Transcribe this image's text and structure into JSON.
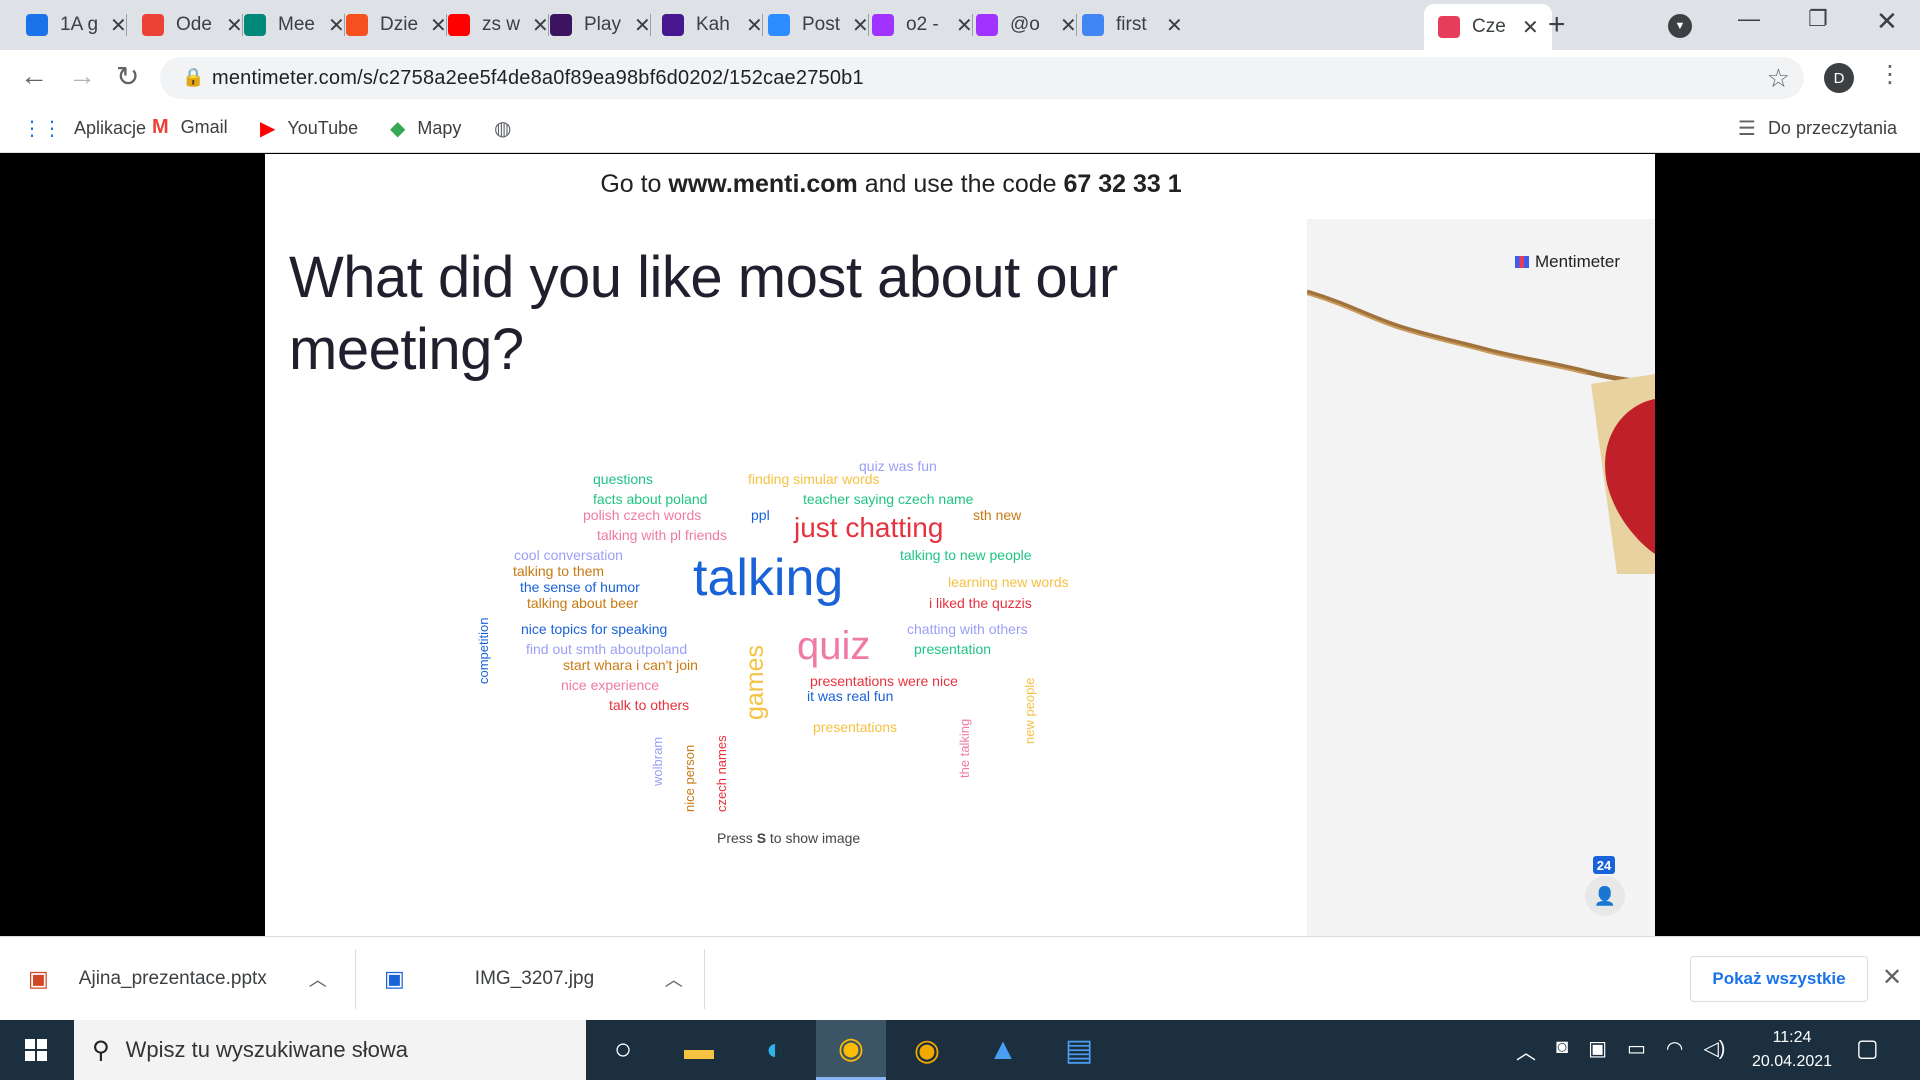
{
  "browser": {
    "tabs": [
      {
        "title": "1A g",
        "icon": "contacts-icon",
        "color": "#1a73e8"
      },
      {
        "title": "Ode",
        "icon": "gmail-icon",
        "color": "#ea4335"
      },
      {
        "title": "Mee",
        "icon": "meet-icon",
        "color": "#00897b"
      },
      {
        "title": "Dzie",
        "icon": "plus-app-icon",
        "color": "#f4511e"
      },
      {
        "title": "zs w",
        "icon": "youtube-icon",
        "color": "#ff0000"
      },
      {
        "title": "Play",
        "icon": "quizlet-icon",
        "color": "#3c1361"
      },
      {
        "title": "Kah",
        "icon": "kahoot-icon",
        "color": "#46178f"
      },
      {
        "title": "Post",
        "icon": "zoom-icon",
        "color": "#2d8cff"
      },
      {
        "title": "o2 -",
        "icon": "messenger-icon",
        "color": "#a033ff"
      },
      {
        "title": "@o",
        "icon": "messenger-icon",
        "color": "#a033ff"
      },
      {
        "title": "first",
        "icon": "google-icon",
        "color": "#4285f4"
      },
      {
        "title": "Cze",
        "icon": "mentimeter-icon",
        "color": "#e63d5a"
      }
    ],
    "url": "mentimeter.com/s/c2758a2ee5f4de8a0f89ea98bf6d0202/152cae2750b1",
    "profile_initial": "D",
    "bookmarks": [
      {
        "label": "Aplikacje",
        "icon": "apps-grid-icon"
      },
      {
        "label": "Gmail",
        "icon": "gmail-icon"
      },
      {
        "label": "YouTube",
        "icon": "youtube-icon"
      },
      {
        "label": "Mapy",
        "icon": "maps-icon"
      },
      {
        "label": "",
        "icon": "globe-icon"
      }
    ],
    "reading_list": "Do przeczytania"
  },
  "slide": {
    "code_prefix": "Go to ",
    "code_site": "www.menti.com",
    "code_middle": " and use the code ",
    "code_value": "67 32 33 1",
    "question": "What did you like most about our meeting?",
    "press_hint_pre": "Press ",
    "press_hint_key": "S",
    "press_hint_post": " to show image",
    "brand": "Mentimeter",
    "participants": "24"
  },
  "wordcloud": [
    {
      "text": "questions",
      "color": "#20c386"
    },
    {
      "text": "finding simular words",
      "color": "#f5c242"
    },
    {
      "text": "quiz was fun",
      "color": "#9a9ff5"
    },
    {
      "text": "facts about poland",
      "color": "#20c386"
    },
    {
      "text": "teacher saying czech name",
      "color": "#20c386"
    },
    {
      "text": "polish czech words",
      "color": "#f07aa5"
    },
    {
      "text": "ppl",
      "color": "#1a62d8"
    },
    {
      "text": "sth new",
      "color": "#c77a12"
    },
    {
      "text": "talking with pl friends",
      "color": "#f07aa5"
    },
    {
      "text": "just chatting",
      "color": "#e6323e"
    },
    {
      "text": "cool conversation",
      "color": "#9a9ff5"
    },
    {
      "text": "talking to new people",
      "color": "#20c386"
    },
    {
      "text": "talking to them",
      "color": "#c77a12"
    },
    {
      "text": "talking",
      "color": "#1a62d8"
    },
    {
      "text": "learning new words",
      "color": "#f5c242"
    },
    {
      "text": "the sense of humor",
      "color": "#1a62d8"
    },
    {
      "text": "talking about beer",
      "color": "#c77a12"
    },
    {
      "text": "i liked the quzzis",
      "color": "#e6323e"
    },
    {
      "text": "nice topics for speaking",
      "color": "#1a62d8"
    },
    {
      "text": "chatting with others",
      "color": "#9a9ff5"
    },
    {
      "text": "competition",
      "color": "#1a62d8"
    },
    {
      "text": "find out smth aboutpoland",
      "color": "#9a9ff5"
    },
    {
      "text": "quiz",
      "color": "#f07aa5"
    },
    {
      "text": "presentation",
      "color": "#20c386"
    },
    {
      "text": "start whara i can't join",
      "color": "#c77a12"
    },
    {
      "text": "games",
      "color": "#f5c242"
    },
    {
      "text": "presentations were nice",
      "color": "#e6323e"
    },
    {
      "text": "nice experience",
      "color": "#f07aa5"
    },
    {
      "text": "it was real fun",
      "color": "#1a62d8"
    },
    {
      "text": "new people",
      "color": "#f5c242"
    },
    {
      "text": "talk to others",
      "color": "#e6323e"
    },
    {
      "text": "presentations",
      "color": "#f5c242"
    },
    {
      "text": "wolbram",
      "color": "#9a9ff5"
    },
    {
      "text": "nice person",
      "color": "#c77a12"
    },
    {
      "text": "czech names",
      "color": "#e6323e"
    },
    {
      "text": "the talking",
      "color": "#f07aa5"
    }
  ],
  "downloads": [
    {
      "name": "Ajina_prezentace.pptx",
      "icon": "pptx-file-icon"
    },
    {
      "name": "IMG_3207.jpg",
      "icon": "image-file-icon"
    }
  ],
  "show_all_label": "Pokaż wszystkie",
  "taskbar": {
    "search_placeholder": "Wpisz tu wyszukiwane słowa",
    "apps": [
      "cortana-icon",
      "file-explorer-icon",
      "edge-icon",
      "chrome-icon",
      "chrome-canary-icon",
      "photos-icon",
      "notepad-icon"
    ],
    "time": "11:24",
    "date": "20.04.2021"
  }
}
